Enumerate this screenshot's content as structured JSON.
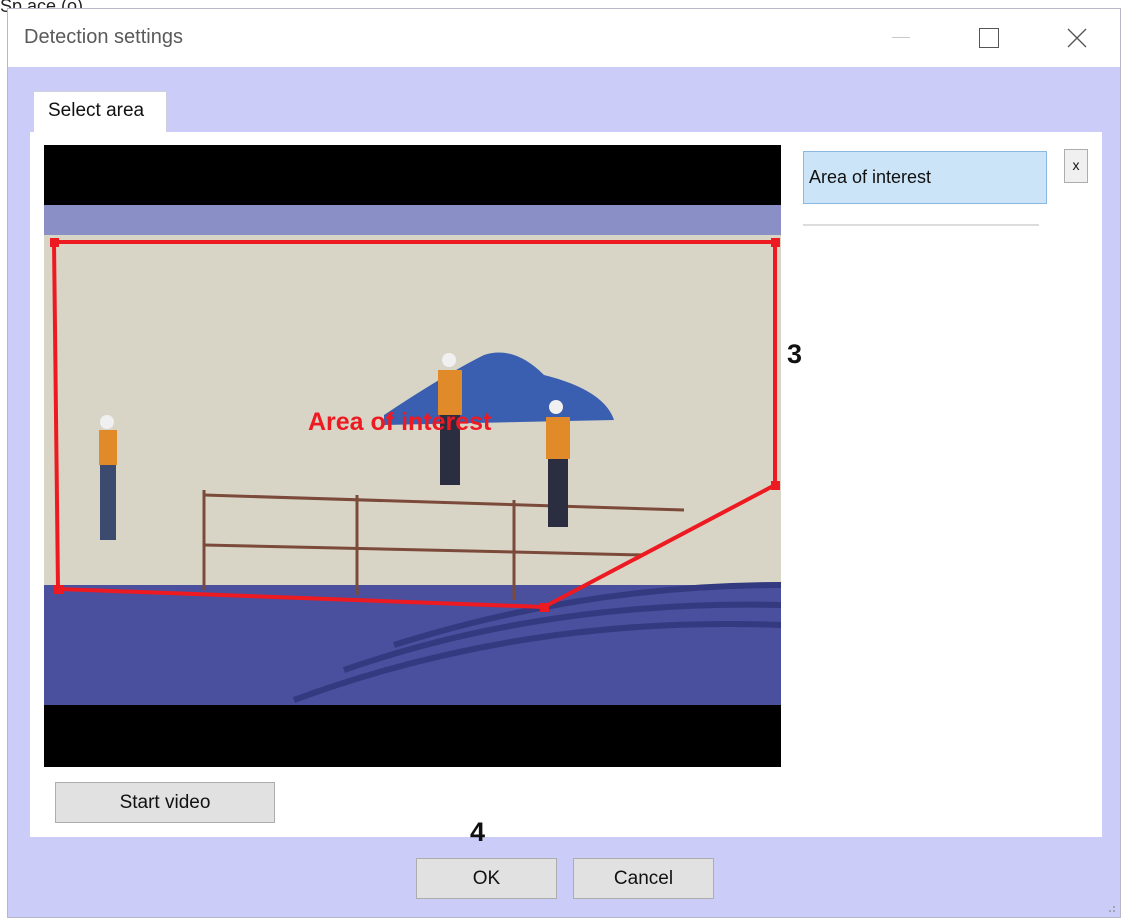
{
  "top_text": "Sp ace (o)",
  "window": {
    "title": "Detection settings",
    "controls": [
      "minimize-icon",
      "maximize-icon",
      "close-icon"
    ]
  },
  "tabs": [
    {
      "label": "Select area"
    }
  ],
  "video": {
    "zone_label": "Area of interest",
    "zone_color": "#ee1a22"
  },
  "area_list": {
    "selected_value": "Area of interest",
    "remove_label": "x"
  },
  "buttons": {
    "start_video": "Start video",
    "ok": "OK",
    "cancel": "Cancel"
  },
  "markers": {
    "m3": "3",
    "m4": "4"
  },
  "colors": {
    "dialog_bg": "#ccccf8",
    "selected_item": "#cce4f7"
  }
}
